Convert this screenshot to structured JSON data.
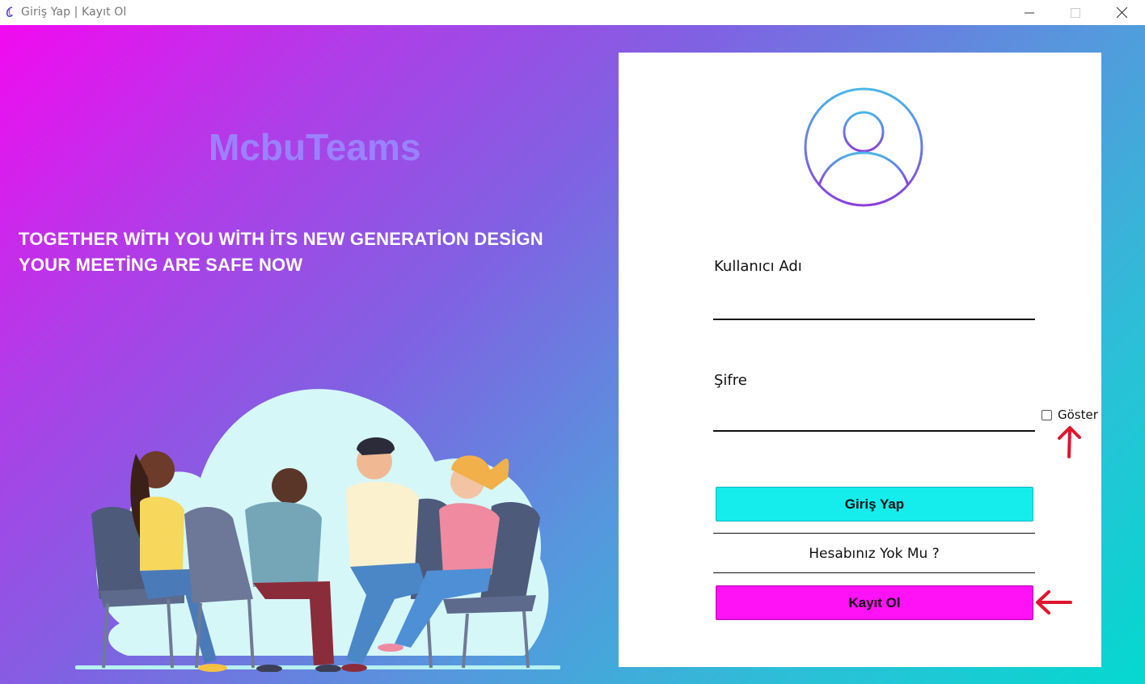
{
  "window": {
    "title": "Giriş Yap | Kayıt Ol",
    "app_icon": "app-logo-icon",
    "controls": [
      "minimize-icon",
      "maximize-icon",
      "close-icon"
    ]
  },
  "left": {
    "brand": "McbuTeams",
    "slogan_line1": "TOGETHER WİTH YOU WİTH İTS NEW GENERATİON DESİGN",
    "slogan_line2": "YOUR MEETİNG ARE SAFE NOW"
  },
  "form": {
    "avatar_icon": "user-avatar-icon",
    "username_label": "Kullanıcı Adı",
    "username_value": "",
    "password_label": "Şifre",
    "password_value": "",
    "show_password_label": "Göster",
    "show_password_checked": false,
    "login_button": "Giriş Yap",
    "no_account_text": "Hesabınız Yok Mu ?",
    "register_button": "Kayıt Ol"
  },
  "colors": {
    "gradient_start": "#f20af0",
    "gradient_end": "#05d8d0",
    "login_button": "#15eded",
    "register_button": "#ff12f6",
    "annotation_arrow": "#e0142c"
  }
}
